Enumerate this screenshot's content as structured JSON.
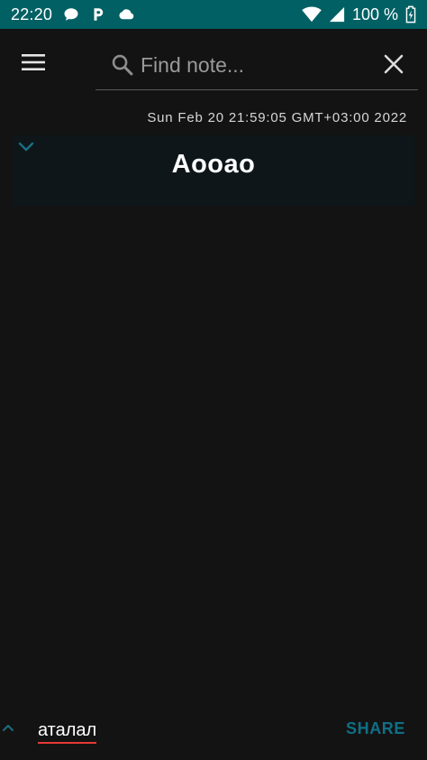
{
  "status_bar": {
    "time": "22:20",
    "battery": "100 %",
    "background": "#006064",
    "icons": [
      "chat-bubble-icon",
      "parking-icon",
      "cloud-icon",
      "wifi-icon",
      "cellular-signal-icon",
      "battery-charging-icon"
    ]
  },
  "app_bar": {
    "menu_icon": "hamburger-menu-icon",
    "search": {
      "placeholder": "Find note...",
      "value": ""
    },
    "close_icon": "close-icon"
  },
  "note": {
    "timestamp": "Sun Feb 20 21:59:05 GMT+03:00 2022",
    "title": "Aooao",
    "expand_icon": "chevron-down-icon",
    "card_color": "#0e1619"
  },
  "bottom_bar": {
    "collapse_icon": "chevron-up-icon",
    "input_text": "аталал",
    "share_label": "SHARE",
    "accent": "#0f6f86"
  }
}
